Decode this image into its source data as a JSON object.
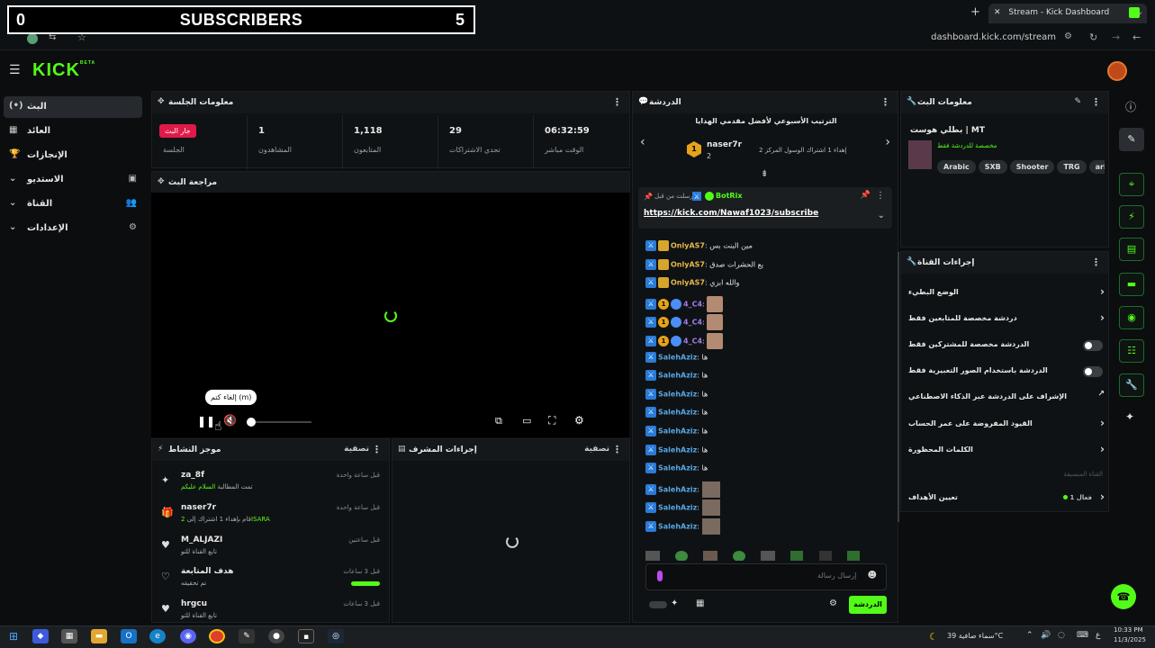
{
  "browser": {
    "tab_title": "Stream - Kick Dashboard",
    "url": "dashboard.kick.com/stream",
    "new_tab": "+"
  },
  "overlay": {
    "left_count": "0",
    "label": "SUBSCRIBERS",
    "right_count": "5"
  },
  "app": {
    "logo": "KICK",
    "logo_badge": "BETA"
  },
  "nav": {
    "items": [
      {
        "label": "البث",
        "icon": "(•)"
      },
      {
        "label": "العائد",
        "icon": "▦"
      },
      {
        "label": "الإنجازات",
        "icon": "🏆"
      },
      {
        "label": "الاستديو",
        "icon": "▣"
      },
      {
        "label": "القناة",
        "icon": "👥"
      },
      {
        "label": "الإعدادات",
        "icon": "⚙"
      }
    ]
  },
  "session": {
    "title": "معلومات الجلسة",
    "stats": [
      {
        "value": "جار البث",
        "label": "الجلسة"
      },
      {
        "value": "1",
        "label": "المشاهدون"
      },
      {
        "value": "1,118",
        "label": "المتابعون"
      },
      {
        "value": "29",
        "label": "تحدي الاشتراكات"
      },
      {
        "value": "06:32:59",
        "label": "الوقت مباشر"
      }
    ]
  },
  "preview": {
    "title": "مراجعة البث",
    "tooltip": "إلغاء كتم (m)"
  },
  "activity": {
    "title": "موجز النشاط",
    "filter": "تصفية",
    "items": [
      {
        "name": "za_8f",
        "desc_pre": "تمت المطالبة",
        "desc_hl": "السلام عليكم",
        "time": "قبل ساعة واحدة",
        "icon": "✦"
      },
      {
        "name": "naser7r",
        "desc_pre": "قام بإهداء 1 اشتراك إلى",
        "desc_hl": "2ISARA",
        "time": "قبل ساعة واحدة",
        "icon": "🎁"
      },
      {
        "name": "M_ALJAZI",
        "desc_pre": "تابع القناة للتو",
        "desc_hl": "",
        "time": "قبل ساعتين",
        "icon": "♥"
      },
      {
        "name": "هدف المتابعة",
        "desc_pre": "تم تحقيقه",
        "desc_hl": "",
        "time": "قبل 3 ساعات",
        "icon": "♡"
      },
      {
        "name": "hrgcu",
        "desc_pre": "تابع القناة للتو",
        "desc_hl": "",
        "time": "قبل 3 ساعات",
        "icon": "♥"
      }
    ]
  },
  "modactions": {
    "title": "إجراءات المشرف",
    "filter": "تصفية"
  },
  "chat": {
    "title": "الدردشة",
    "leaderboard_title": "الترتيب الأسبوعي لأفضل مقدمي الهدايا",
    "top_gifter": "naser7r",
    "top_gifter_count": "2",
    "top_gifter_desc": "إهداء 1 اشتراك الوسول المركز 2",
    "pinned_by": "أرسلت من قبل",
    "pinned_user": "BotRix",
    "pinned_link": "https://kick.com/Nawaf1023/subscribe",
    "lines": [
      {
        "user": "OnlyAS7",
        "msg": "مين البنت بس",
        "color": "#e8b84a",
        "badges": [
          "mod",
          "crown"
        ]
      },
      {
        "user": "OnlyAS7",
        "msg": "يع الحشرات صدق",
        "color": "#e8b84a",
        "badges": [
          "mod",
          "crown"
        ]
      },
      {
        "user": "OnlyAS7",
        "msg": "والله ابزي",
        "color": "#e8b84a",
        "badges": [
          "mod",
          "crown"
        ]
      },
      {
        "user": "4_C4",
        "msg": "",
        "color": "#a77cf0",
        "badges": [
          "mod",
          "one",
          "ver"
        ],
        "avatar": true
      },
      {
        "user": "4_C4",
        "msg": "",
        "color": "#a77cf0",
        "badges": [
          "mod",
          "one",
          "ver"
        ],
        "avatar": true
      },
      {
        "user": "4_C4",
        "msg": "",
        "color": "#a77cf0",
        "badges": [
          "mod",
          "one",
          "ver"
        ],
        "avatar": true
      },
      {
        "user": "SalehAziz",
        "msg": "ها",
        "color": "#56a8e8",
        "badges": [
          "mod"
        ]
      },
      {
        "user": "SalehAziz",
        "msg": "ها",
        "color": "#56a8e8",
        "badges": [
          "mod"
        ]
      },
      {
        "user": "SalehAziz",
        "msg": "ها",
        "color": "#56a8e8",
        "badges": [
          "mod"
        ]
      },
      {
        "user": "SalehAziz",
        "msg": "ها",
        "color": "#56a8e8",
        "badges": [
          "mod"
        ]
      },
      {
        "user": "SalehAziz",
        "msg": "ها",
        "color": "#56a8e8",
        "badges": [
          "mod"
        ]
      },
      {
        "user": "SalehAziz",
        "msg": "ها",
        "color": "#56a8e8",
        "badges": [
          "mod"
        ]
      },
      {
        "user": "SalehAziz",
        "msg": "ها",
        "color": "#56a8e8",
        "badges": [
          "mod"
        ]
      },
      {
        "user": "SalehAziz",
        "msg": "",
        "color": "#56a8e8",
        "badges": [
          "mod"
        ],
        "emote": true
      },
      {
        "user": "SalehAziz",
        "msg": "",
        "color": "#56a8e8",
        "badges": [
          "mod"
        ],
        "emote": true
      },
      {
        "user": "SalehAziz",
        "msg": "",
        "color": "#56a8e8",
        "badges": [
          "mod"
        ],
        "emote": true
      }
    ],
    "input_placeholder": "إرسال رسالة",
    "send_button": "الدردشة"
  },
  "streaminfo": {
    "title": "معلومات البث",
    "stream_title": "بطلي هوست | MT",
    "category": "مخصصة للدردشة فقط",
    "tags": [
      "Arabic",
      "SXB",
      "Shooter",
      "TRG",
      "arb"
    ]
  },
  "channelactions": {
    "title": "إجراءات القناة",
    "rows": [
      {
        "label": "الوضع البطيء",
        "type": "arrow"
      },
      {
        "label": "دردشة مخصصة للمتابعين فقط",
        "type": "arrow"
      },
      {
        "label": "الدردشة مخصصة للمشتركين فقط",
        "type": "toggle"
      },
      {
        "label": "الدردشة باستخدام الصور التعبيرية فقط",
        "type": "toggle"
      },
      {
        "label": "الإشراف على الدردشة عبر الذكاء الاصطناعي",
        "type": "ext"
      },
      {
        "label": "القيود المفروضة على عمر الحساب",
        "type": "arrow"
      },
      {
        "label": "الكلمات المحظورة",
        "type": "arrow"
      }
    ],
    "section_label": "القناة المنسيقة",
    "goals_label": "تعيين الأهداف",
    "goals_status": "فعال 1"
  },
  "taskbar": {
    "weather": "سماء صافية 39°C",
    "time": "10:33 PM",
    "date": "11/3/2025",
    "lang": "ع"
  },
  "colors": {
    "accent": "#53fc18",
    "live": "#e0194b"
  }
}
